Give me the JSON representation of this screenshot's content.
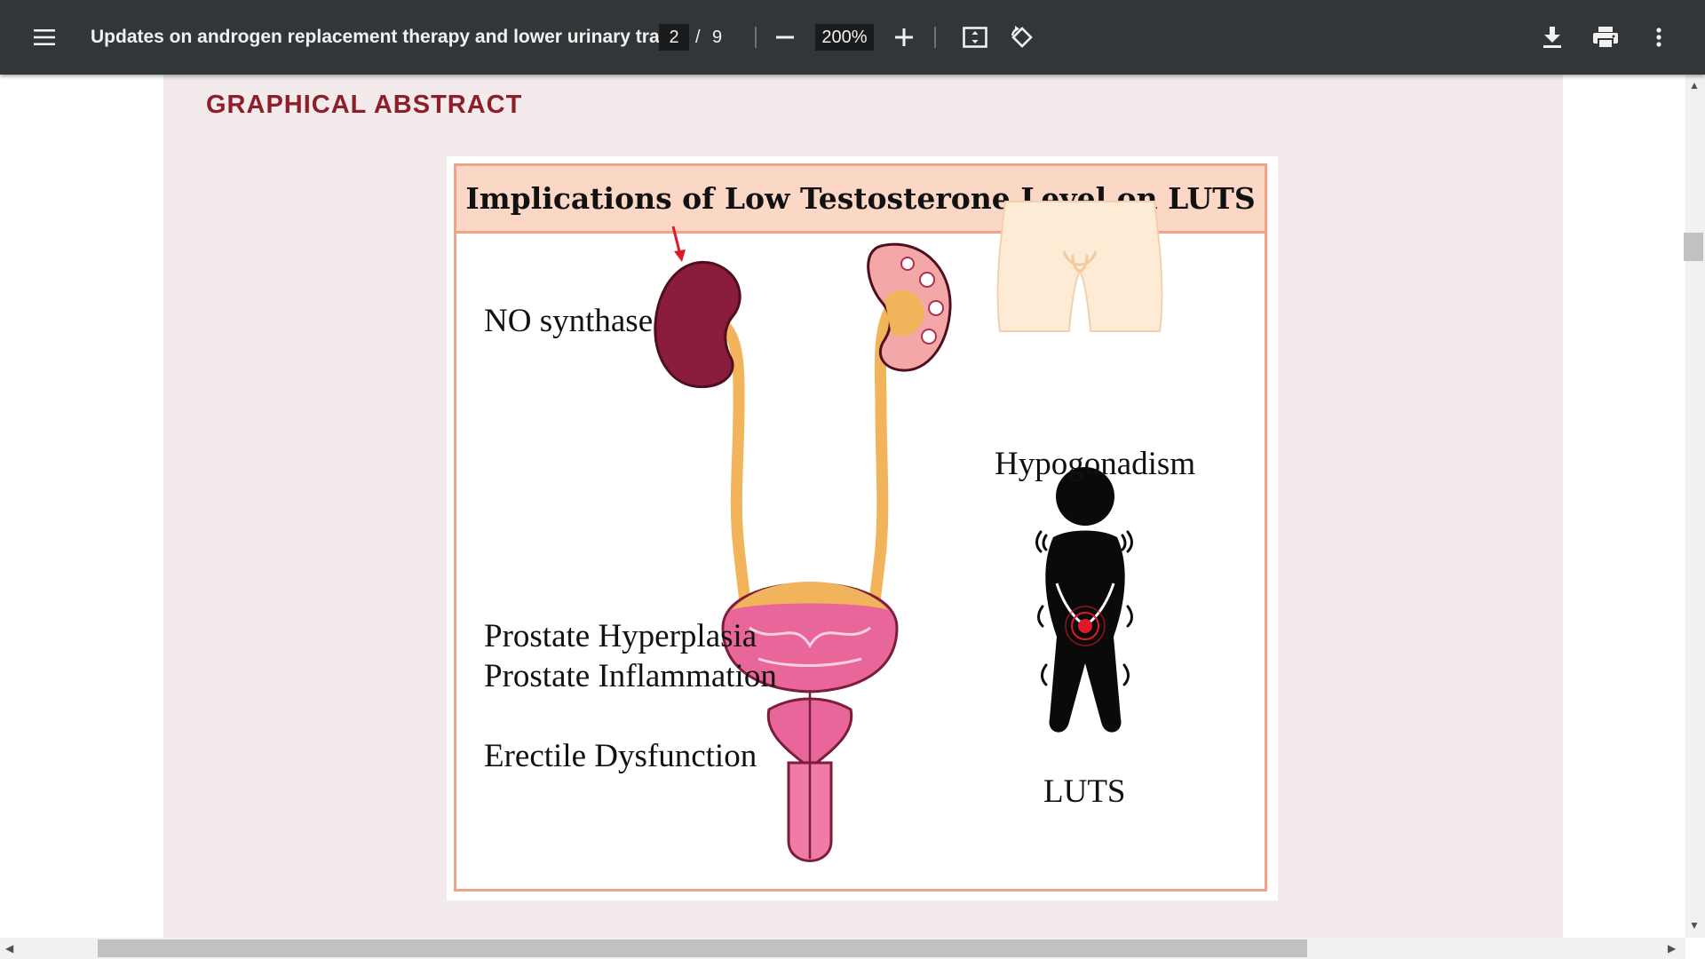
{
  "toolbar": {
    "menu_icon": "hamburger-menu-icon",
    "title": "Updates on androgen replacement therapy and lower urinary tra...",
    "current_page": "2",
    "page_separator": "/",
    "total_pages": "9",
    "zoom_out_icon": "minus-icon",
    "zoom_level": "200%",
    "zoom_in_icon": "plus-icon",
    "fit_page_icon": "fit-to-page-icon",
    "rotate_icon": "rotate-counterclockwise-icon",
    "download_icon": "download-icon",
    "print_icon": "print-icon",
    "more_icon": "more-vertical-icon"
  },
  "document": {
    "section_heading": "GRAPHICAL ABSTRACT",
    "abstract": {
      "title": "Implications of Low Testosterone Level on LUTS",
      "labels": {
        "no_synthase": "NO synthase",
        "hypogonadism": "Hypogonadism",
        "prostate_hyperplasia": "Prostate Hyperplasia",
        "prostate_inflammation": "Prostate Inflammation",
        "erectile_dysfunction": "Erectile Dysfunction",
        "luts": "LUTS"
      }
    }
  },
  "colors": {
    "toolbar_bg": "#323639",
    "page_bg": "#f3eaeb",
    "heading": "#8e1f2a",
    "title_bar": "#fbd7c5",
    "border": "#f0a389",
    "kidney": "#8b1d3c",
    "ureter": "#f1b45a",
    "bladder": "#e8669a",
    "down_arrow": "#e0192a"
  }
}
